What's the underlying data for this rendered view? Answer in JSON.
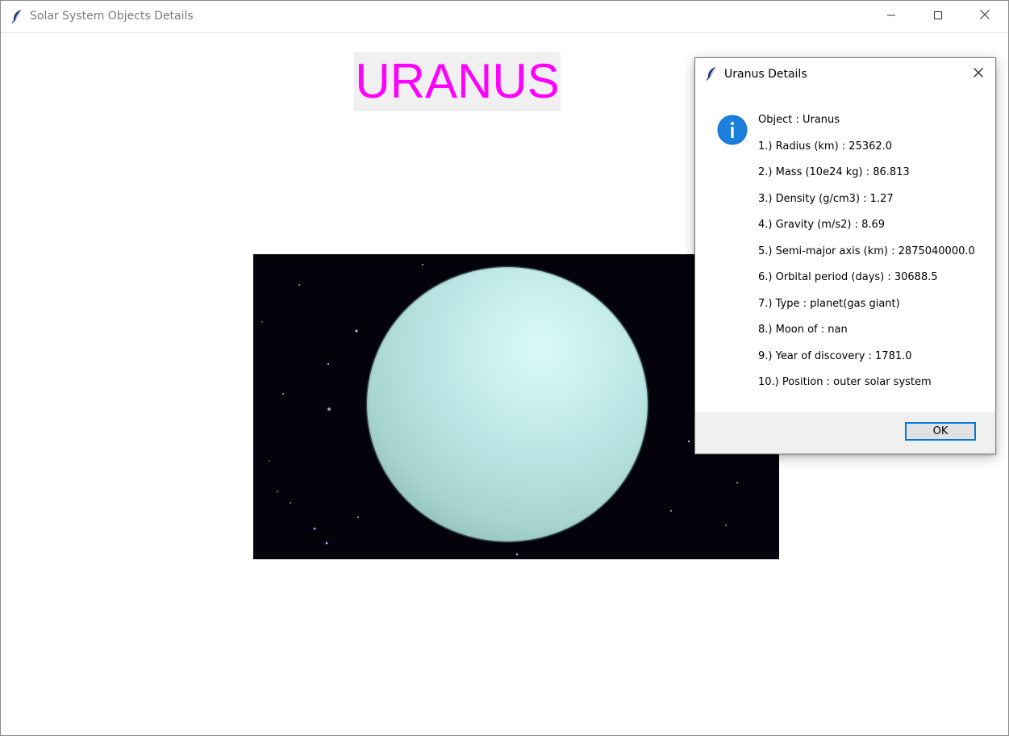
{
  "window": {
    "title": "Solar System Objects Details",
    "app_icon": "feather-icon",
    "controls": [
      "minimize-icon",
      "maximize-icon",
      "close-icon"
    ]
  },
  "main": {
    "planet_name": "URANUS",
    "planet_name_color": "#ff00ff",
    "image": "uranus-planet-image"
  },
  "dialog": {
    "title": "Uranus Details",
    "icon": "info-icon",
    "lines": [
      "Object  :  Uranus",
      "1.)  Radius (km)  :  25362.0",
      "2.)  Mass (10e24 kg)  :  86.813",
      "3.)  Density (g/cm3)  :  1.27",
      "4.)  Gravity (m/s2)  :  8.69",
      "5.)  Semi-major axis (km)  :  2875040000.0",
      "6.)  Orbital period (days)  :  30688.5",
      "7.)  Type  :  planet(gas giant)",
      "8.)  Moon of  :  nan",
      "9.)  Year of discovery  :  1781.0",
      "10.)  Position  :  outer solar system"
    ],
    "ok_label": "OK"
  },
  "colors": {
    "accent": "#0078d7",
    "info": "#0a6fcf",
    "space": "#04030c",
    "planet": "#b6e3e4"
  }
}
